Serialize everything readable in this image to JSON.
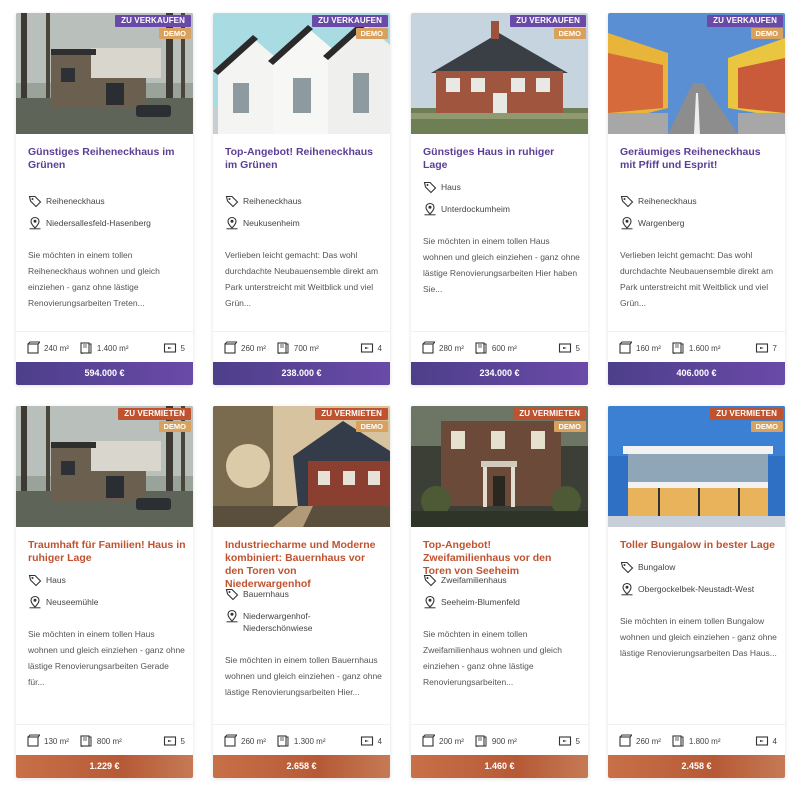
{
  "colors": {
    "purple": "#5b3f96",
    "copper": "#c0532f",
    "demo": "#d9a15e",
    "sale_badge": "#6a4aa8",
    "rent_badge": "#c0532f"
  },
  "cards": [
    {
      "status": "ZU VERKAUFEN",
      "demo": "DEMO",
      "title": "Günstiges Reiheneckhaus im Grünen",
      "type": "Reiheneckhaus",
      "location": "Niedersallesfeld-Hasenberg",
      "description": "Sie möchten in einem tollen Reiheneckhaus wohnen und gleich einziehen - ganz ohne lästige Renovierungsarbeiten Treten...",
      "area": "240 m²",
      "plot": "1.400 m²",
      "rooms": "5",
      "price": "594.000 €",
      "theme": "purple"
    },
    {
      "status": "ZU VERKAUFEN",
      "demo": "DEMO",
      "title": "Top-Angebot! Reiheneckhaus im Grünen",
      "type": "Reiheneckhaus",
      "location": "Neukusenheim",
      "description": "Verlieben leicht gemacht: Das wohl durchdachte Neubauensemble direkt am Park unterstreicht mit Weitblick und viel Grün...",
      "area": "260 m²",
      "plot": "700 m²",
      "rooms": "4",
      "price": "238.000 €",
      "theme": "purple"
    },
    {
      "status": "ZU VERKAUFEN",
      "demo": "DEMO",
      "title": "Günstiges Haus in ruhiger Lage",
      "type": "Haus",
      "location": "Unterdockumheim",
      "description": "Sie möchten in einem tollen Haus wohnen und gleich einziehen - ganz ohne lästige Renovierungsarbeiten Hier haben Sie...",
      "area": "280 m²",
      "plot": "600 m²",
      "rooms": "5",
      "price": "234.000 €",
      "theme": "purple"
    },
    {
      "status": "ZU VERKAUFEN",
      "demo": "DEMO",
      "title": "Geräumiges Reiheneckhaus mit Pfiff und Esprit!",
      "type": "Reiheneckhaus",
      "location": "Wargenberg",
      "description": "Verlieben leicht gemacht: Das wohl durchdachte Neubauensemble direkt am Park unterstreicht mit Weitblick und viel Grün...",
      "area": "160 m²",
      "plot": "1.600 m²",
      "rooms": "7",
      "price": "406.000 €",
      "theme": "purple"
    },
    {
      "status": "ZU VERMIETEN",
      "demo": "DEMO",
      "title": "Traumhaft für Familien! Haus in ruhiger Lage",
      "type": "Haus",
      "location": "Neuseemühle",
      "description": "Sie möchten in einem tollen Haus wohnen und gleich einziehen - ganz ohne lästige Renovierungsarbeiten Gerade für...",
      "area": "130 m²",
      "plot": "800 m²",
      "rooms": "5",
      "price": "1.229 €",
      "theme": "copper"
    },
    {
      "status": "ZU VERMIETEN",
      "demo": "DEMO",
      "title": "Industriecharme und Moderne kombiniert: Bauernhaus vor den Toren von Niederwargenhof",
      "type": "Bauernhaus",
      "location": "Niederwargenhof-Niederschönwiese",
      "description": "Sie möchten in einem tollen Bauernhaus wohnen und gleich einziehen - ganz ohne lästige Renovierungsarbeiten Hier...",
      "area": "260 m²",
      "plot": "1.300 m²",
      "rooms": "4",
      "price": "2.658 €",
      "theme": "copper"
    },
    {
      "status": "ZU VERMIETEN",
      "demo": "DEMO",
      "title": "Top-Angebot! Zweifamilienhaus vor den Toren von Seeheim",
      "type": "Zweifamilienhaus",
      "location": "Seeheim-Blumenfeld",
      "description": "Sie möchten in einem tollen Zweifamilienhaus wohnen und gleich einziehen - ganz ohne lästige Renovierungsarbeiten...",
      "area": "200 m²",
      "plot": "900 m²",
      "rooms": "5",
      "price": "1.460 €",
      "theme": "copper"
    },
    {
      "status": "ZU VERMIETEN",
      "demo": "DEMO",
      "title": "Toller Bungalow in bester Lage",
      "type": "Bungalow",
      "location": "Obergockelbek-Neustadt-West",
      "description": "Sie möchten in einem tollen Bungalow wohnen und gleich einziehen - ganz ohne lästige Renovierungsarbeiten Das Haus...",
      "area": "260 m²",
      "plot": "1.800 m²",
      "rooms": "4",
      "price": "2.458 €",
      "theme": "copper"
    }
  ]
}
